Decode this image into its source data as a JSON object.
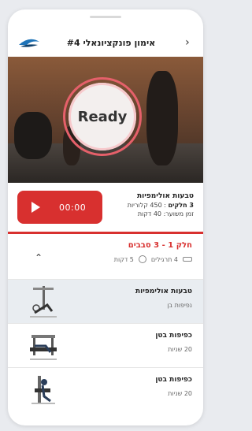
{
  "header": {
    "title": "אימון פונקציונאלי #4"
  },
  "video": {
    "ready_label": "Ready"
  },
  "info": {
    "time": "00:00",
    "title": "טבעות אולימפיות",
    "parts_strong": "3 חלקים",
    "parts_rest": " : 450 קלוריות",
    "duration": "זמן משוער: 40 דקות"
  },
  "section": {
    "title": "חלק 1 - 3 סבבים",
    "equipment": "4 תרגילים",
    "minutes": "5 דקות"
  },
  "exercises": [
    {
      "name": "טבעות אולימפיות",
      "detail": "נפיפות בן"
    },
    {
      "name": "כפיפות בטן",
      "detail": "20 שניות"
    },
    {
      "name": "כפיפות בטן",
      "detail": "20 שניות"
    }
  ],
  "colors": {
    "accent": "#d8302f",
    "ring": "#e5606a"
  }
}
